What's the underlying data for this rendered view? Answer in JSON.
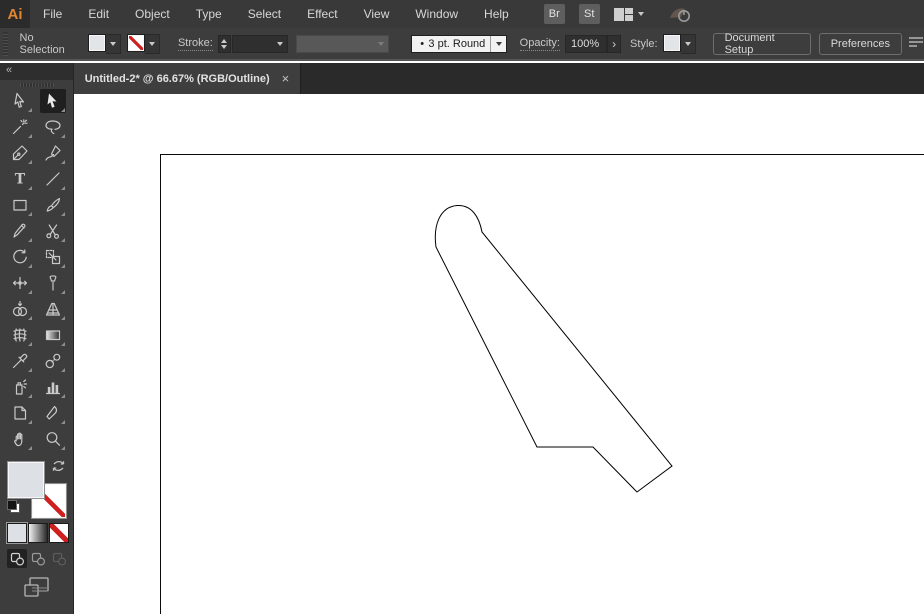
{
  "app": {
    "logo": "Ai"
  },
  "menubar": {
    "items": [
      "File",
      "Edit",
      "Object",
      "Type",
      "Select",
      "Effect",
      "View",
      "Window",
      "Help"
    ],
    "bridge_button": "Br",
    "stock_button": "St"
  },
  "controlbar": {
    "selection_status": "No Selection",
    "stroke_label": "Stroke:",
    "brush_bullet": "•",
    "brush_value": "3 pt. Round",
    "opacity_label": "Opacity:",
    "opacity_value": "100%",
    "forward_arrow": "›",
    "style_label": "Style:",
    "document_setup_button": "Document Setup",
    "preferences_button": "Preferences"
  },
  "tabbar": {
    "active_tab_title": "Untitled-2* @ 66.67% (RGB/Outline)",
    "close_glyph": "×"
  },
  "toolbar": {
    "collapse_glyph": "«",
    "type_glyph": "T",
    "tools": [
      {
        "name": "direct-selection-tool",
        "active": false
      },
      {
        "name": "selection-tool",
        "active": true
      },
      {
        "name": "magic-wand-tool",
        "active": false
      },
      {
        "name": "lasso-tool",
        "active": false
      },
      {
        "name": "pen-tool",
        "active": false
      },
      {
        "name": "curvature-tool",
        "active": false
      },
      {
        "name": "type-tool",
        "active": false
      },
      {
        "name": "line-segment-tool",
        "active": false
      },
      {
        "name": "rectangle-tool",
        "active": false
      },
      {
        "name": "paintbrush-tool",
        "active": false
      },
      {
        "name": "pencil-tool",
        "active": false
      },
      {
        "name": "scissors-tool",
        "active": false
      },
      {
        "name": "rotate-tool",
        "active": false
      },
      {
        "name": "scale-tool",
        "active": false
      },
      {
        "name": "width-tool",
        "active": false
      },
      {
        "name": "free-transform-tool",
        "active": false
      },
      {
        "name": "shape-builder-tool",
        "active": false
      },
      {
        "name": "perspective-grid-tool",
        "active": false
      },
      {
        "name": "mesh-tool",
        "active": false
      },
      {
        "name": "gradient-tool",
        "active": false
      },
      {
        "name": "eyedropper-tool",
        "active": false
      },
      {
        "name": "blend-tool",
        "active": false
      },
      {
        "name": "symbol-sprayer-tool",
        "active": false
      },
      {
        "name": "column-graph-tool",
        "active": false
      },
      {
        "name": "artboard-tool",
        "active": false
      },
      {
        "name": "slice-tool",
        "active": false
      },
      {
        "name": "hand-tool",
        "active": false
      },
      {
        "name": "zoom-tool",
        "active": false
      }
    ]
  },
  "canvas": {
    "document_color_mode": "RGB",
    "view_mode": "Outline",
    "zoom_percent": "66.67%"
  },
  "colors": {
    "logo_orange": "#e5862f",
    "ui_bar": "#3d3d3d",
    "ui_dark_bar": "#2a2a2a",
    "none_red": "#cf2020",
    "artboard_outline": "#0a0a0a",
    "shape_stroke": "#000000"
  }
}
